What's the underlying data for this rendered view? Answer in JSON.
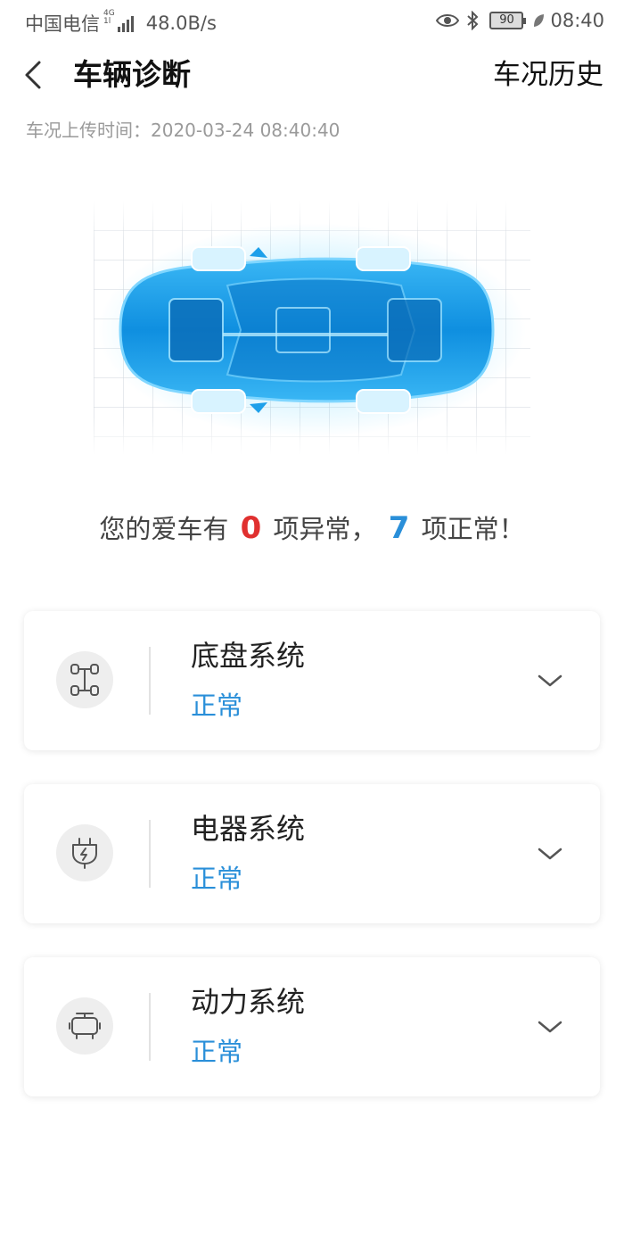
{
  "status_bar": {
    "carrier": "中国电信",
    "network_gen_top": "4G",
    "network_gen_bottom": "1l",
    "speed": "48.0B/s",
    "battery": "90",
    "time": "08:40"
  },
  "header": {
    "title": "车辆诊断",
    "history_link": "车况历史"
  },
  "upload_time": "车况上传时间：2020-03-24 08:40:40",
  "summary": {
    "prefix": "您的爱车有",
    "abnormal_count": "0",
    "middle": "项异常，",
    "normal_count": "7",
    "suffix": "项正常！"
  },
  "systems": [
    {
      "name": "底盘系统",
      "status": "正常",
      "icon": "chassis-icon"
    },
    {
      "name": "电器系统",
      "status": "正常",
      "icon": "electric-plug-icon"
    },
    {
      "name": "动力系统",
      "status": "正常",
      "icon": "engine-icon"
    }
  ],
  "colors": {
    "normal": "#2a8fd9",
    "abnormal": "#e0302f",
    "car_blue": "#1ea0ea"
  }
}
